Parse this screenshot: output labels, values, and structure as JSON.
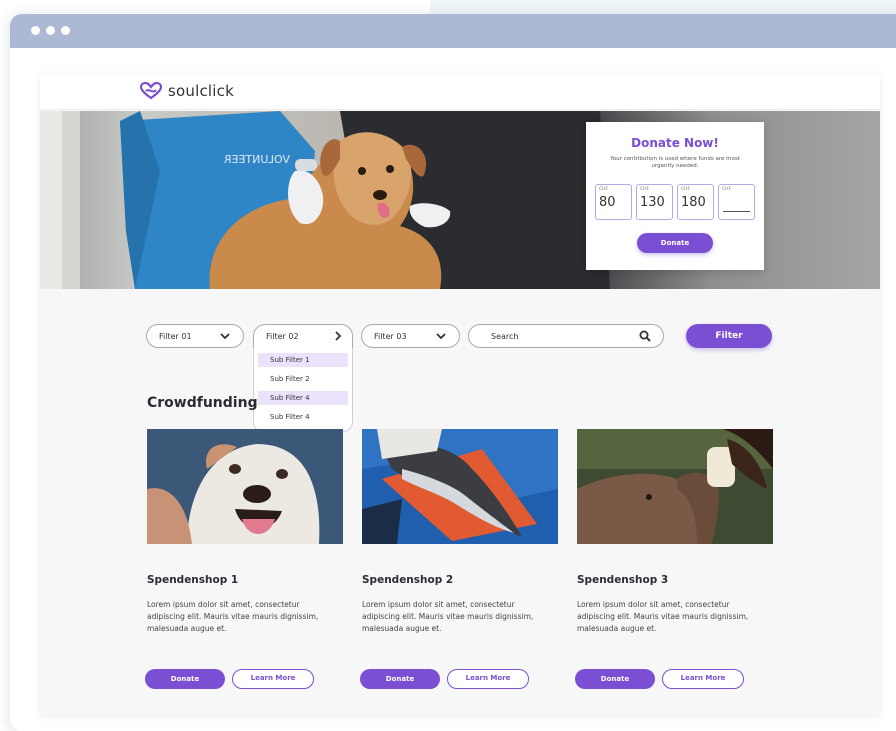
{
  "brand": {
    "name": "soulclick",
    "accent": "#7b4fd3"
  },
  "hero": {
    "volunteer_text": "VOLUNTEER",
    "donate_card": {
      "title": "Donate Now!",
      "description": "Your contribution is used where funds are most urgently needed.",
      "currency": "CHF",
      "amounts": [
        "80",
        "130",
        "180"
      ],
      "custom_placeholder": "",
      "button_label": "Donate"
    }
  },
  "filters": {
    "filter1_label": "Filter 01",
    "filter2_label": "Filter 02",
    "filter3_label": "Filter 03",
    "search_placeholder": "Search",
    "filter_button_label": "Filter",
    "subfilters": [
      "Sub Filter 1",
      "Sub Filter 2",
      "Sub Filter 4",
      "Sub Filter 4"
    ]
  },
  "section_title": "Crowdfunding",
  "cards": [
    {
      "title": "Spendenshop 1",
      "description": "Lorem ipsum dolor sit amet, consectetur adipiscing elit. Mauris vitae mauris dignissim, malesuada augue et.",
      "donate_label": "Donate",
      "learn_label": "Learn More",
      "image": "dog-photo"
    },
    {
      "title": "Spendenshop 2",
      "description": "Lorem ipsum dolor sit amet, consectetur adipiscing elit. Mauris vitae mauris dignissim, malesuada augue et.",
      "donate_label": "Donate",
      "learn_label": "Learn More",
      "image": "dolphin-photo"
    },
    {
      "title": "Spendenshop 3",
      "description": "Lorem ipsum dolor sit amet, consectetur adipiscing elit. Mauris vitae mauris dignissim, malesuada augue et.",
      "donate_label": "Donate",
      "learn_label": "Learn More",
      "image": "elephant-photo"
    }
  ]
}
